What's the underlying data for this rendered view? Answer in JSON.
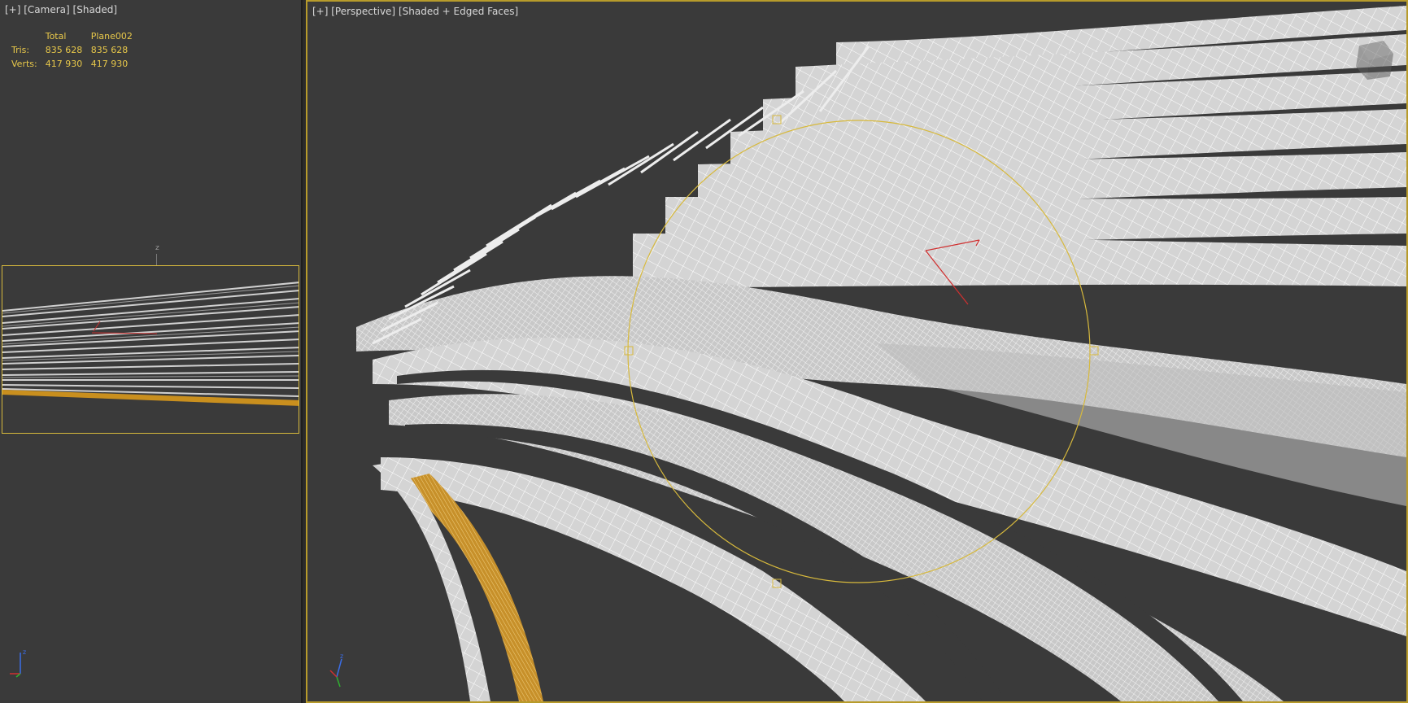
{
  "left_viewport": {
    "label": {
      "plus": "[+]",
      "view": "[Camera]",
      "shading": "[Shaded]"
    },
    "stats": {
      "headers": [
        "",
        "Total",
        "Plane002"
      ],
      "rows": [
        {
          "label": "Tris:",
          "total": "835 628",
          "object": "835 628"
        },
        {
          "label": "Verts:",
          "total": "417 930",
          "object": "417 930"
        }
      ]
    },
    "axis_label_z": "z"
  },
  "right_viewport": {
    "label": {
      "plus": "[+]",
      "view": "[Perspective]",
      "shading": "[Shaded + Edged Faces]"
    },
    "active_border_color": "#b79b2b"
  },
  "colors": {
    "background": "#3a3a3a",
    "stats_text": "#e8c84a",
    "selection": "#d7b93c",
    "mesh": "#dedede",
    "highlight_mesh": "#c98f1e"
  },
  "gizmo_axes": [
    "x",
    "y",
    "z"
  ]
}
